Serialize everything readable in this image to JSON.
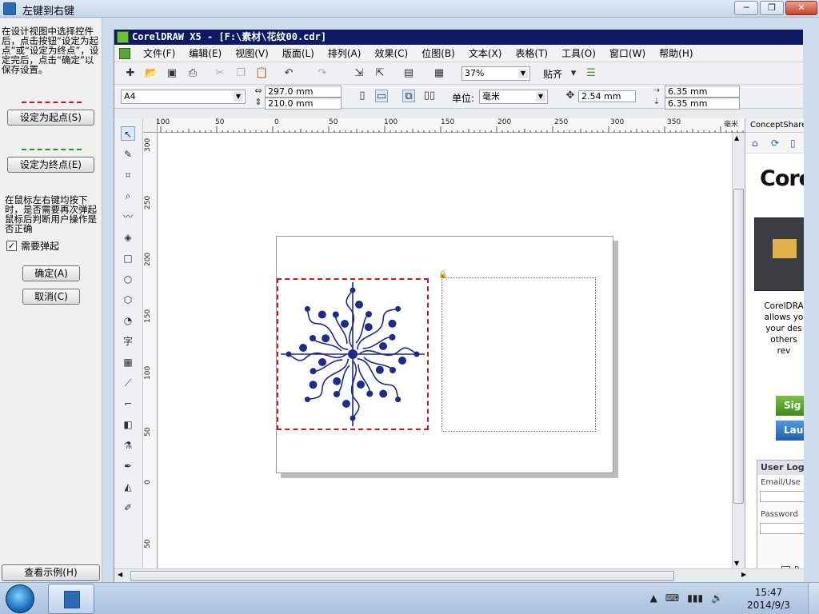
{
  "outer_window": {
    "title": "左键到右键"
  },
  "window_controls": {
    "minimize": "─",
    "maximize": "❐",
    "close": "✕"
  },
  "left_panel": {
    "instructions": "在设计视图中选择控件后，点击按钮“设定为起点”或“设定为终点”，设定完后，点击“确定”以保存设置。",
    "set_start_button": "设定为起点(S)",
    "set_end_button": "设定为终点(E)",
    "instructions2": "在鼠标左右键均按下时，是否需要再次弹起鼠标后判断用户操作是否正确",
    "checkbox_label": "需要弹起",
    "checkbox_checked": "✓",
    "ok_button": "确定(A)",
    "cancel_button": "取消(C)",
    "view_example_button": "查看示例(H)",
    "colors": {
      "start_dash": "#e01010",
      "end_dash": "#12a012"
    }
  },
  "coreldraw": {
    "title": "CorelDRAW X5 - [F:\\素材\\花纹00.cdr]",
    "menu": [
      "文件(F)",
      "编辑(E)",
      "视图(V)",
      "版面(L)",
      "排列(A)",
      "效果(C)",
      "位图(B)",
      "文本(X)",
      "表格(T)",
      "工具(O)",
      "窗口(W)",
      "帮助(H)"
    ],
    "toolbar": {
      "zoom": "37%",
      "snap_label": "贴齐"
    },
    "property_bar": {
      "paper": "A4",
      "width": "297.0 mm",
      "height": "210.0 mm",
      "units_label": "单位:",
      "units_value": "毫米",
      "nudge": "2.54 mm",
      "dup_x": "6.35 mm",
      "dup_y": "6.35 mm"
    },
    "ruler": {
      "h_labels": [
        "100",
        "50",
        "0",
        "50",
        "100",
        "150",
        "200",
        "250",
        "300",
        "350",
        "毫米"
      ],
      "v_labels": [
        "300",
        "250",
        "200",
        "150",
        "100",
        "50",
        "0",
        "50"
      ]
    },
    "docker": {
      "title": "ConceptShare",
      "brand": "Corel",
      "promo_lines": [
        "CorelDRA",
        "allows yo",
        "your des",
        "others",
        "rev"
      ],
      "sign_button": "Sig",
      "launch_button": "Lau",
      "login_header": "User Log",
      "email_label": "Email/Use",
      "password_label": "Password",
      "remember_label": "R"
    }
  },
  "taskbar": {
    "time": "15:47",
    "date": "2014/9/3",
    "tray_icons": [
      "▲",
      "⌨",
      "▮▮▮",
      "🔊"
    ]
  }
}
